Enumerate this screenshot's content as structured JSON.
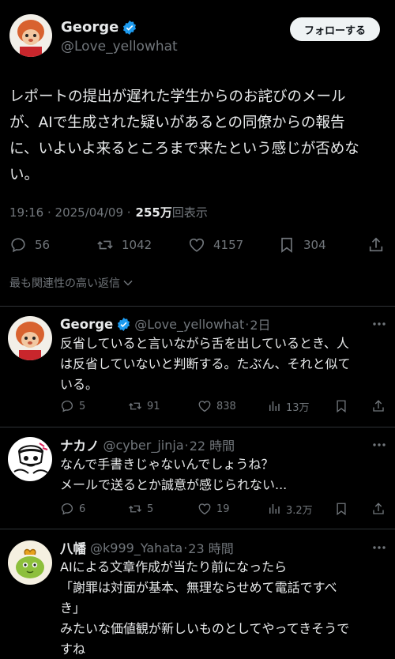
{
  "post": {
    "author_name": "George",
    "author_handle": "@Love_yellowhat",
    "follow_label": "フォローする",
    "text_lines": [
      "レポートの提出が遅れた学生からのお詫びのメール",
      "が、AIで生成された疑いがあるとの同僚からの報告",
      "に、いよいよ来るところまで来たという感じが否めな",
      "い。"
    ],
    "time": "19:16 · 2025/04/09 · ",
    "views_count": "255万",
    "views_label": "回表示",
    "replies": "56",
    "reposts": "1042",
    "likes": "4157",
    "bookmarks": "304"
  },
  "replies_filter_label": "最も関連性の高い返信",
  "colors": {
    "background": "#000000",
    "text": "#e7e9ea",
    "secondary": "#71767b",
    "verified": "#1d9bf0",
    "divider": "#2f3336"
  },
  "replies_list": [
    {
      "name": "George",
      "handle": "@Love_yellowhat",
      "time": "2日",
      "verified": true,
      "text_lines": [
        "反省していると言いながら舌を出しているとき、人",
        "は反省していないと判断する。たぶん、それと似て",
        "いる。"
      ],
      "replies": "5",
      "reposts": "91",
      "likes": "838",
      "views": "13万"
    },
    {
      "name": "ナカノ",
      "handle": "@cyber_jinja",
      "time": "22 時間",
      "text_lines": [
        "なんで手書きじゃないんでしょうね？",
        "メールで送るとか誠意が感じられない..."
      ],
      "replies": "6",
      "reposts": "5",
      "likes": "19",
      "views": "3.2万"
    },
    {
      "name": "八幡",
      "handle": "@k999_Yahata",
      "time": "23 時間",
      "text_lines": [
        "AIによる文章作成が当たり前になったら",
        "「謝罪は対面が基本、無理ならせめて電話ですべ",
        "き」",
        "みたいな価値観が新しいものとしてやってきそうで",
        "すね"
      ]
    }
  ]
}
